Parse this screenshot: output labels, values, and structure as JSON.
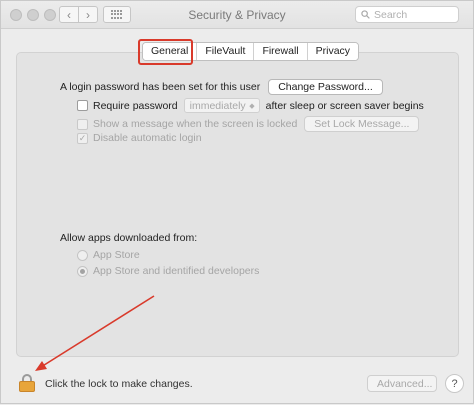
{
  "window": {
    "title": "Security & Privacy",
    "back_icon": "chevron-left-icon",
    "forward_icon": "chevron-right-icon",
    "grid_icon": "show-all-grid-icon"
  },
  "search": {
    "placeholder": "Search",
    "value": ""
  },
  "tabs": [
    {
      "label": "General",
      "selected": true
    },
    {
      "label": "FileVault"
    },
    {
      "label": "Firewall"
    },
    {
      "label": "Privacy"
    }
  ],
  "general": {
    "login_password_text": "A login password has been set for this user",
    "change_password_button": "Change Password...",
    "require_password": {
      "label": "Require password",
      "checked": false,
      "select_value": "immediately",
      "suffix": "after sleep or screen saver begins"
    },
    "show_message": {
      "label": "Show a message when the screen is locked",
      "checked": false,
      "button": "Set Lock Message..."
    },
    "disable_auto_login": {
      "label": "Disable automatic login",
      "checked": true,
      "check_glyph": "✓"
    }
  },
  "allow_apps": {
    "label": "Allow apps downloaded from:",
    "options": [
      {
        "label": "App Store",
        "selected": false
      },
      {
        "label": "App Store and identified developers",
        "selected": true
      }
    ]
  },
  "footer": {
    "lock_text": "Click the lock to make changes.",
    "advanced_button": "Advanced...",
    "help_glyph": "?"
  },
  "colors": {
    "annotation_red": "#d93a2b",
    "lock_gold": "#e8a53b"
  }
}
